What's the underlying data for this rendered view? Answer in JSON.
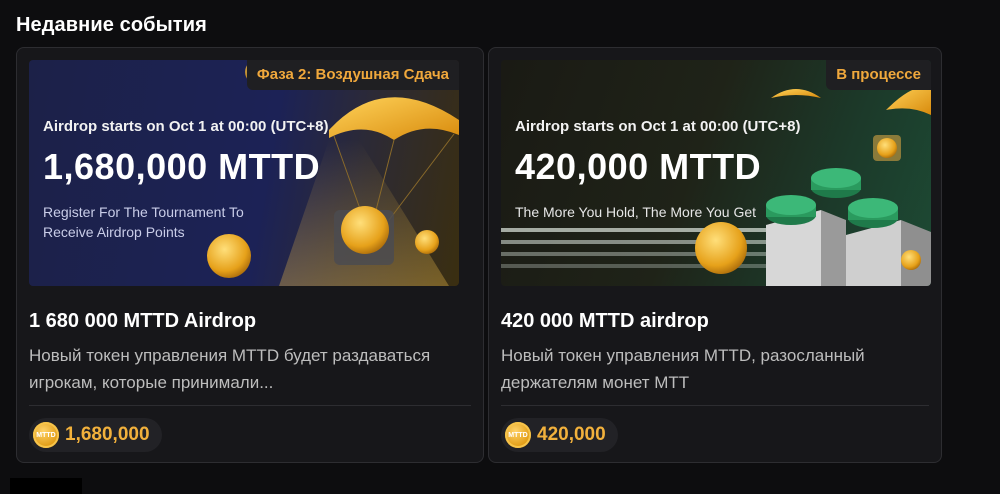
{
  "section": {
    "title": "Недавние события"
  },
  "cards": [
    {
      "badge": "Фаза 2: Воздушная Сдача",
      "banner_subtitle": "Airdrop starts on Oct 1 at 00:00 (UTC+8)",
      "banner_amount": "1,680,000 MTTD",
      "banner_desc": "Register For The Tournament To Receive Airdrop Points",
      "title": "1 680 000 MTTD Airdrop",
      "desc": "Новый токен управления MTTD будет раздаваться игрокам, которые принимали...",
      "coin_label": "MTTD",
      "amount": "1,680,000"
    },
    {
      "badge": "В процессе",
      "banner_subtitle": "Airdrop starts on Oct 1 at 00:00 (UTC+8)",
      "banner_amount": "420,000 MTTD",
      "banner_desc": "The More You Hold, The More You Get",
      "title": "420 000 MTTD airdrop",
      "desc": "Новый токен управления MTTD, разосланный держателям монет MTT",
      "coin_label": "MTTD",
      "amount": "420,000"
    }
  ],
  "colors": {
    "accent": "#f2b13c",
    "badge_text": "#f0a83c",
    "background": "#0d0d0f",
    "card": "#17171a"
  },
  "icons": {
    "coin": "mttd-coin-icon",
    "parachute": "parachute-icon"
  }
}
